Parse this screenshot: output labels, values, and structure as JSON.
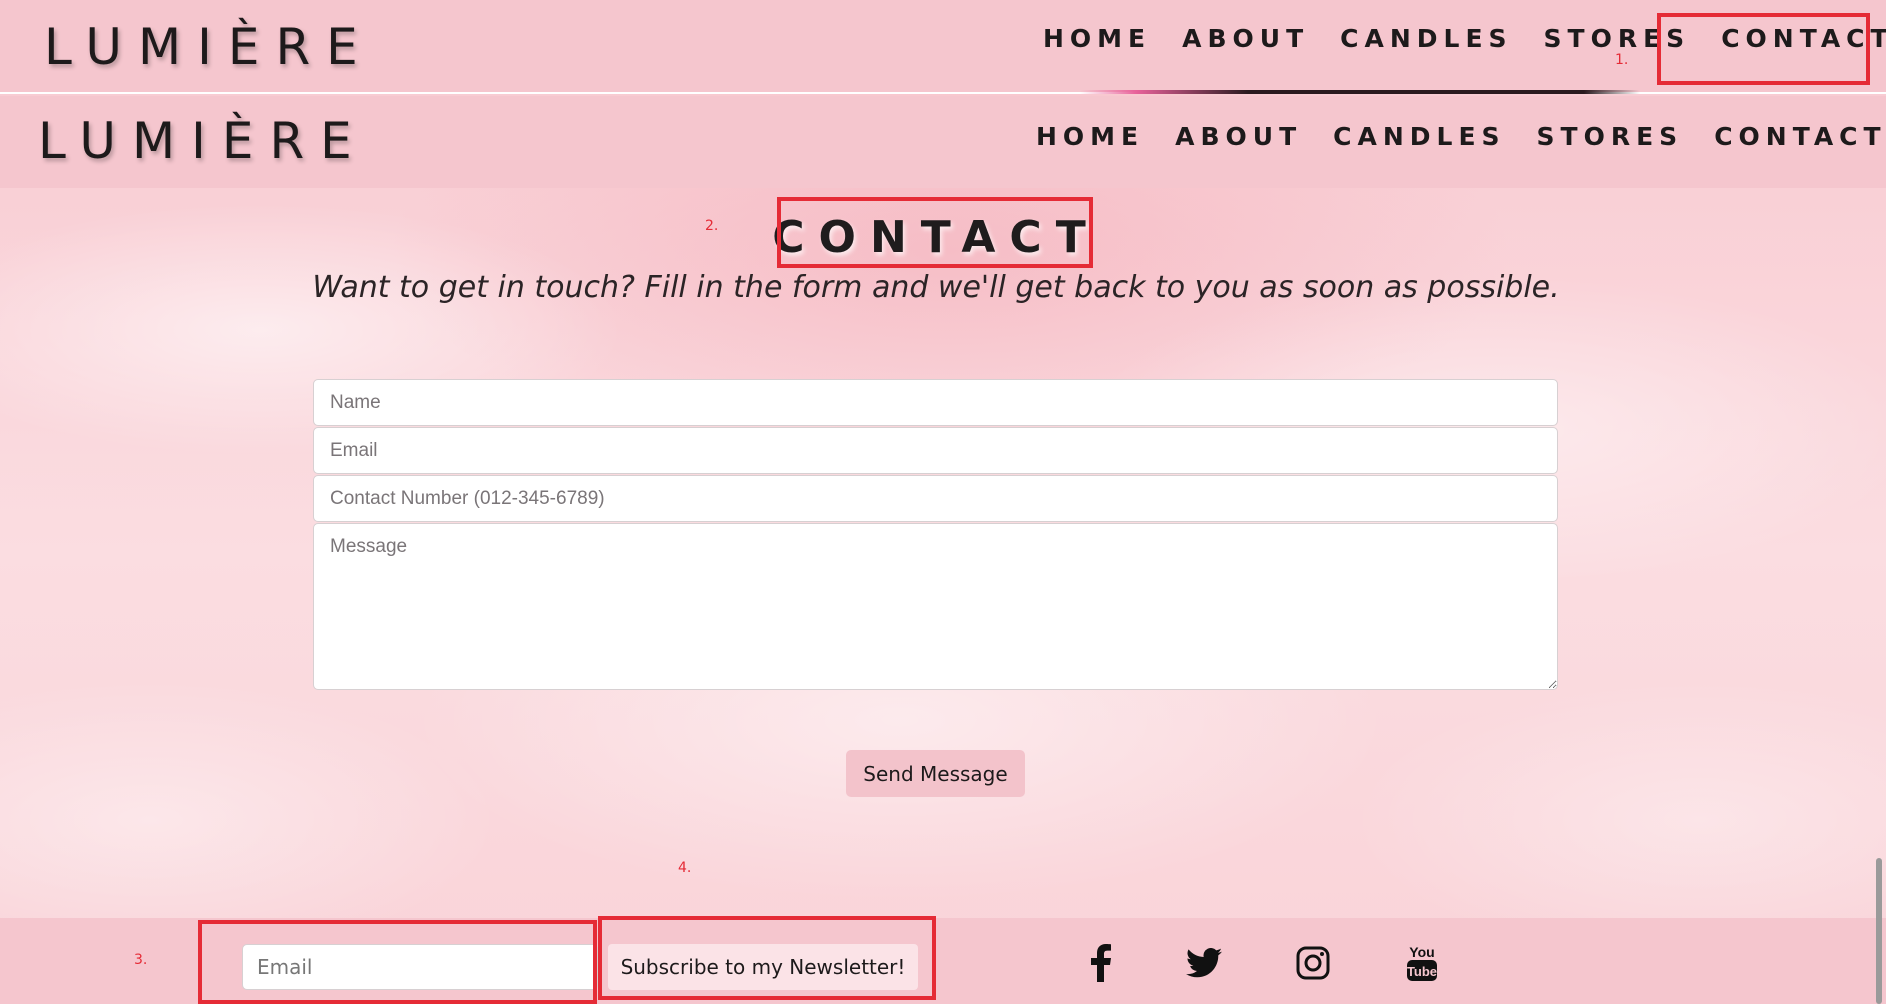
{
  "brand": {
    "logo": "LUMIÈRE"
  },
  "nav": {
    "items": [
      {
        "label": "HOME"
      },
      {
        "label": "ABOUT"
      },
      {
        "label": "CANDLES"
      },
      {
        "label": "STORES"
      },
      {
        "label": "CONTACT"
      }
    ]
  },
  "annotations": [
    "1.",
    "2.",
    "3.",
    "4."
  ],
  "contact": {
    "title": "CONTACT",
    "subtitle": "Want to get in touch? Fill in the form and we'll get back to you as soon as possible.",
    "form": {
      "name_placeholder": "Name",
      "email_placeholder": "Email",
      "phone_placeholder": "Contact Number (012-345-6789)",
      "message_placeholder": "Message",
      "send_label": "Send Message"
    }
  },
  "footer": {
    "email_placeholder": "Email",
    "subscribe_label": "Subscribe to my Newsletter!",
    "social": [
      "facebook-icon",
      "twitter-icon",
      "instagram-icon",
      "youtube-icon"
    ]
  },
  "colors": {
    "nav_bg": "#f5c6ce",
    "annotation_red": "#e52b36",
    "text_dark": "#1d1a1b"
  }
}
